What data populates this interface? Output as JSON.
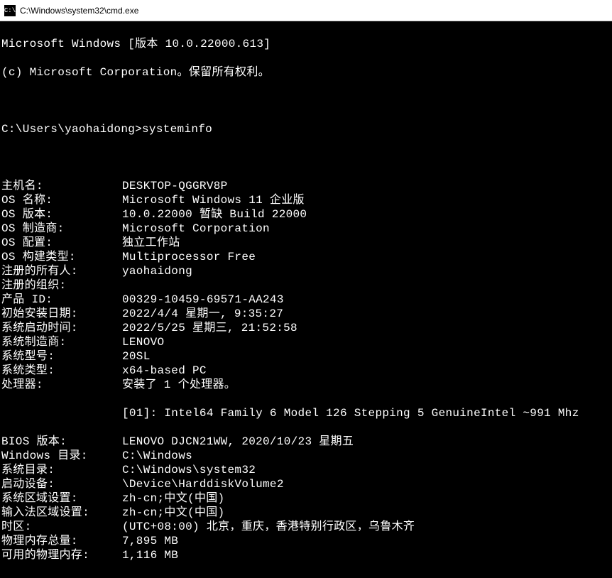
{
  "titlebar": {
    "icon_label": "C:\\",
    "path": "C:\\Windows\\system32\\cmd.exe"
  },
  "header": {
    "line1": "Microsoft Windows [版本 10.0.22000.613]",
    "line2": "(c) Microsoft Corporation。保留所有权利。"
  },
  "prompt": {
    "path": "C:\\Users\\yaohaidong>",
    "command": "systeminfo"
  },
  "systeminfo": {
    "rows": [
      {
        "label": "主机名:",
        "value": "DESKTOP-QGGRV8P"
      },
      {
        "label": "OS 名称:",
        "value": "Microsoft Windows 11 企业版"
      },
      {
        "label": "OS 版本:",
        "value": "10.0.22000 暂缺 Build 22000"
      },
      {
        "label": "OS 制造商:",
        "value": "Microsoft Corporation"
      },
      {
        "label": "OS 配置:",
        "value": "独立工作站"
      },
      {
        "label": "OS 构建类型:",
        "value": "Multiprocessor Free"
      },
      {
        "label": "注册的所有人:",
        "value": "yaohaidong"
      },
      {
        "label": "注册的组织:",
        "value": ""
      },
      {
        "label": "产品 ID:",
        "value": "00329-10459-69571-AA243"
      },
      {
        "label": "初始安装日期:",
        "value": "2022/4/4 星期一, 9:35:27"
      },
      {
        "label": "系统启动时间:",
        "value": "2022/5/25 星期三, 21:52:58"
      },
      {
        "label": "系统制造商:",
        "value": "LENOVO"
      },
      {
        "label": "系统型号:",
        "value": "20SL"
      },
      {
        "label": "系统类型:",
        "value": "x64-based PC"
      },
      {
        "label": "处理器:",
        "value": "安装了 1 个处理器。"
      }
    ],
    "processor_detail": "[01]: Intel64 Family 6 Model 126 Stepping 5 GenuineIntel ~991 Mhz",
    "rows2": [
      {
        "label": "BIOS 版本:",
        "value": "LENOVO DJCN21WW, 2020/10/23 星期五"
      },
      {
        "label": "Windows 目录:",
        "value": "C:\\Windows"
      },
      {
        "label": "系统目录:",
        "value": "C:\\Windows\\system32"
      },
      {
        "label": "启动设备:",
        "value": "\\Device\\HarddiskVolume2"
      },
      {
        "label": "系统区域设置:",
        "value": "zh-cn;中文(中国)"
      },
      {
        "label": "输入法区域设置:",
        "value": "zh-cn;中文(中国)"
      },
      {
        "label": "时区:",
        "value": "(UTC+08:00) 北京，重庆，香港特别行政区，乌鲁木齐"
      },
      {
        "label": "物理内存总量:",
        "value": "7,895 MB"
      },
      {
        "label": "可用的物理内存:",
        "value": "1,116 MB"
      }
    ]
  }
}
